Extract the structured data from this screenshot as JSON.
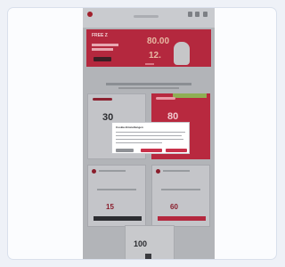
{
  "banner": {
    "headline_left": "FREE\nZ",
    "big_price": "80.00",
    "sub_price": "12.",
    "brand_char": "character"
  },
  "plans": {
    "left_price": "30",
    "right_price": "80",
    "row2_left_price": "15",
    "row2_right_price": "60",
    "row3_price": "100"
  },
  "modal": {
    "title": "Cookie-Einstellungen"
  },
  "icons": {
    "logo": "brand-logo-icon",
    "fab": "whatsapp-chat-icon"
  },
  "colors": {
    "brand_red": "#b4283e",
    "accent_green": "#8fae54",
    "chat_green": "#2aa64a"
  }
}
